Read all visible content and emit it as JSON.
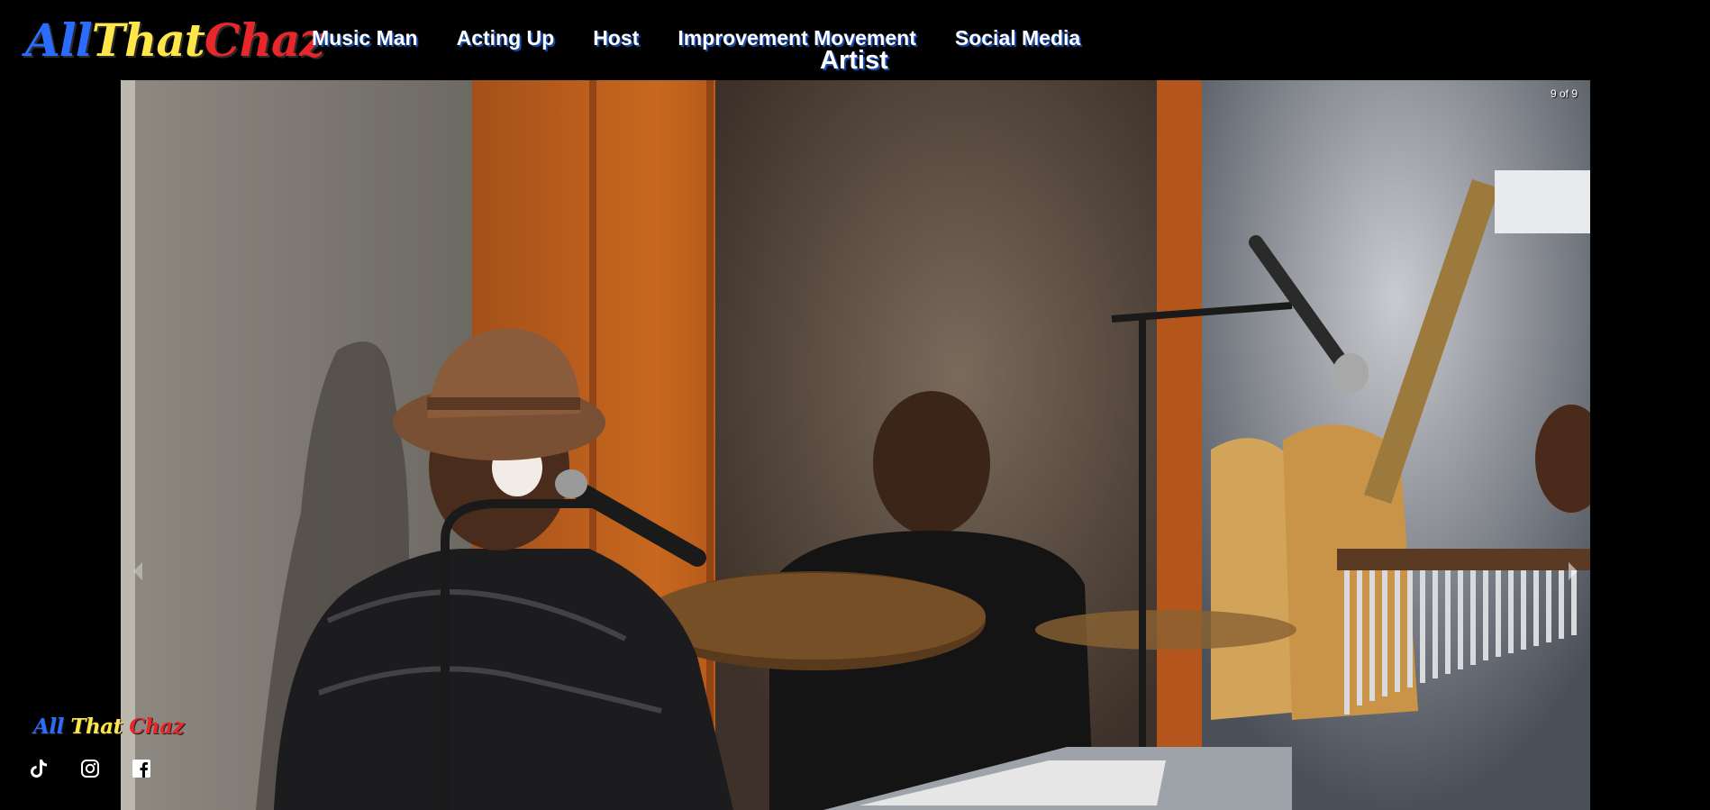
{
  "brand": {
    "logo_parts": [
      "All",
      "That",
      "Chaz"
    ],
    "logo_colors": [
      "#2b6cff",
      "#ffe74a",
      "#e8272b"
    ]
  },
  "nav": {
    "items": [
      "Music Man",
      "Acting Up",
      "Host",
      "Improvement Movement",
      "Social Media"
    ],
    "sub_label": "Artist"
  },
  "slideshow": {
    "counter": "9 of 9",
    "prev_icon": "chevron-left-icon",
    "next_icon": "chevron-right-icon"
  },
  "footer": {
    "logo_parts": [
      "All",
      "That",
      "Chaz"
    ],
    "social_icons": [
      "tiktok-icon",
      "instagram-icon",
      "facebook-icon"
    ]
  },
  "colors": {
    "background": "#000000",
    "nav_shadow": "#1a4fb5",
    "logo_all": "#2b6cff",
    "logo_that": "#ffe74a",
    "logo_chaz": "#e8272b"
  }
}
